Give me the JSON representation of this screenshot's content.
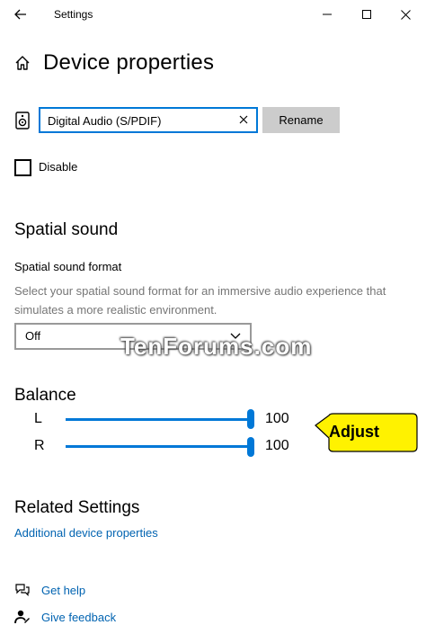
{
  "window": {
    "title": "Settings",
    "back_icon": "arrow-left-icon",
    "minimize_icon": "minimize-icon",
    "maximize_icon": "maximize-icon",
    "close_icon": "close-icon"
  },
  "page": {
    "title": "Device properties",
    "icon": "home-icon"
  },
  "device": {
    "icon": "speaker-icon",
    "name_value": "Digital Audio (S/PDIF)",
    "rename_label": "Rename",
    "disable_label": "Disable",
    "disable_checked": false
  },
  "spatial": {
    "heading": "Spatial sound",
    "format_label": "Spatial sound format",
    "format_description": "Select your spatial sound format for an immersive audio experience that simulates a more realistic environment.",
    "format_selected": "Off"
  },
  "watermark": "TenForums.com",
  "balance": {
    "heading": "Balance",
    "left_label": "L",
    "left_value": "100",
    "right_label": "R",
    "right_value": "100",
    "left_level": 1.0,
    "right_level": 1.0
  },
  "callout": {
    "text": "Adjust",
    "color": "#fff200"
  },
  "related": {
    "heading": "Related Settings",
    "additional_link": "Additional device properties"
  },
  "help": {
    "get_help": "Get help",
    "get_help_icon": "help-chat-icon",
    "give_feedback": "Give feedback",
    "give_feedback_icon": "feedback-icon"
  },
  "colors": {
    "accent": "#0078d7",
    "link": "#0063b1",
    "button_gray": "#cccccc",
    "secondary_text": "#767676"
  }
}
